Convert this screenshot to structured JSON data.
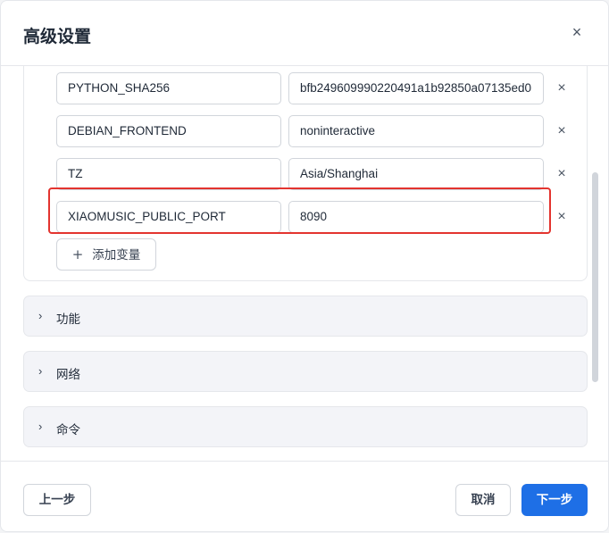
{
  "dialog": {
    "title": "高级设置",
    "close_icon": "close-icon",
    "close_glyph": "×"
  },
  "env": {
    "rows": [
      {
        "key": "PYTHON_SHA256",
        "value": "bfb249609990220491a1b92850a07135ed0"
      },
      {
        "key": "DEBIAN_FRONTEND",
        "value": "noninteractive"
      },
      {
        "key": "TZ",
        "value": "Asia/Shanghai"
      },
      {
        "key": "XIAOMUSIC_PUBLIC_PORT",
        "value": "8090"
      }
    ],
    "remove_glyph": "×",
    "add_button_icon": "+",
    "add_button_label": "添加变量"
  },
  "sections": [
    {
      "label": "功能",
      "icon": "chevron-right-icon",
      "glyph": "›"
    },
    {
      "label": "网络",
      "icon": "chevron-right-icon",
      "glyph": "›"
    },
    {
      "label": "命令",
      "icon": "chevron-right-icon",
      "glyph": "›"
    }
  ],
  "footer": {
    "prev_label": "上一步",
    "cancel_label": "取消",
    "next_label": "下一步"
  },
  "colors": {
    "primary": "#1e6fe6",
    "highlight": "#e3342f",
    "section_bg": "#f3f4f8"
  }
}
